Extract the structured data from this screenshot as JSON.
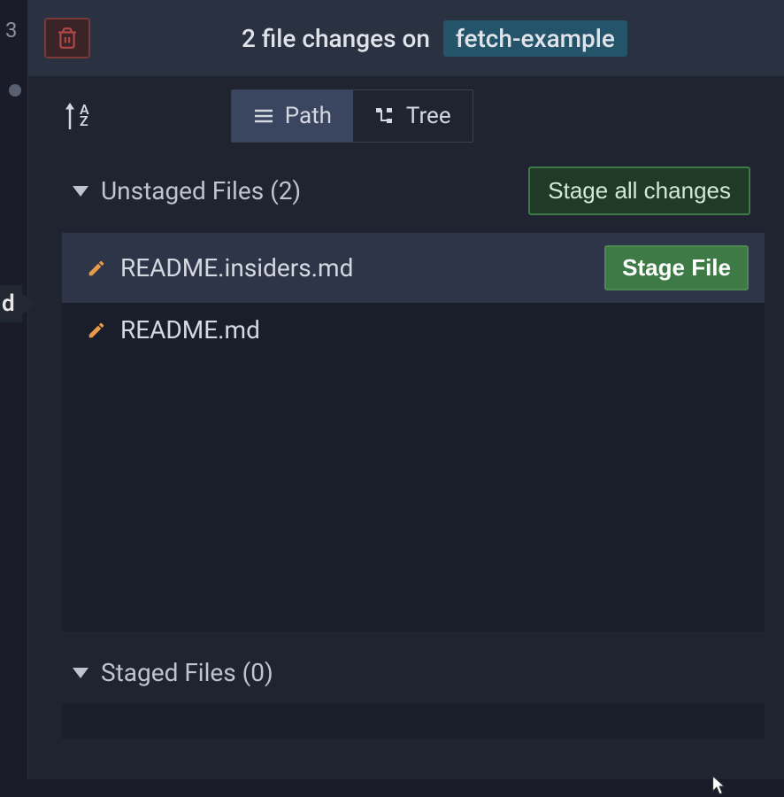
{
  "left_strip": {
    "num": "3"
  },
  "header": {
    "title_prefix": "2 file changes on",
    "branch": "fetch-example"
  },
  "toolbar": {
    "sort_label": "A\nZ",
    "view_path_label": "Path",
    "view_tree_label": "Tree"
  },
  "unstaged": {
    "title": "Unstaged Files (2)",
    "stage_all_label": "Stage all changes",
    "files": [
      {
        "name": "README.insiders.md",
        "hovered": true
      },
      {
        "name": "README.md",
        "hovered": false
      }
    ],
    "stage_file_label": "Stage File"
  },
  "staged": {
    "title": "Staged Files (0)"
  },
  "tag": {
    "label": "d"
  }
}
